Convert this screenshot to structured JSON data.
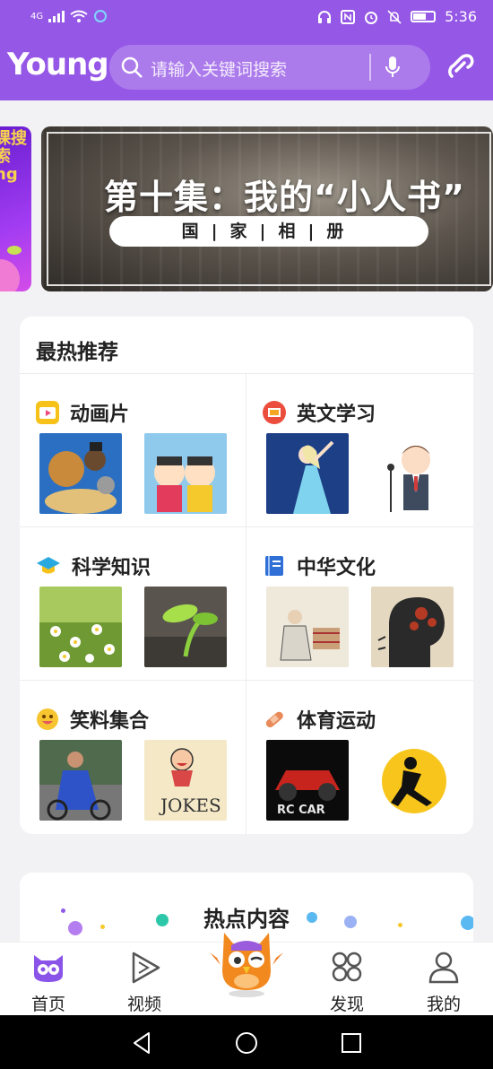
{
  "status": {
    "signal": "4G",
    "time": "5:36"
  },
  "header": {
    "logo": "Young",
    "search_placeholder": "请输入关键词搜索"
  },
  "banner": {
    "side_text": "课搜索\nng",
    "title": "第十集：我的“小人书”",
    "subtitle": "国|家|相|册"
  },
  "hot": {
    "title": "最热推荐",
    "categories": [
      {
        "label": "动画片"
      },
      {
        "label": "英文学习"
      },
      {
        "label": "科学知识"
      },
      {
        "label": "中华文化"
      },
      {
        "label": "笑料集合"
      },
      {
        "label": "体育运动"
      }
    ]
  },
  "hotspot": {
    "title": "热点内容"
  },
  "tabs": [
    {
      "label": "首页"
    },
    {
      "label": "视频"
    },
    {
      "label": "发现"
    },
    {
      "label": "我的"
    }
  ],
  "colors": {
    "brand": "#9557e6",
    "active_tab": "#8a54e8"
  }
}
